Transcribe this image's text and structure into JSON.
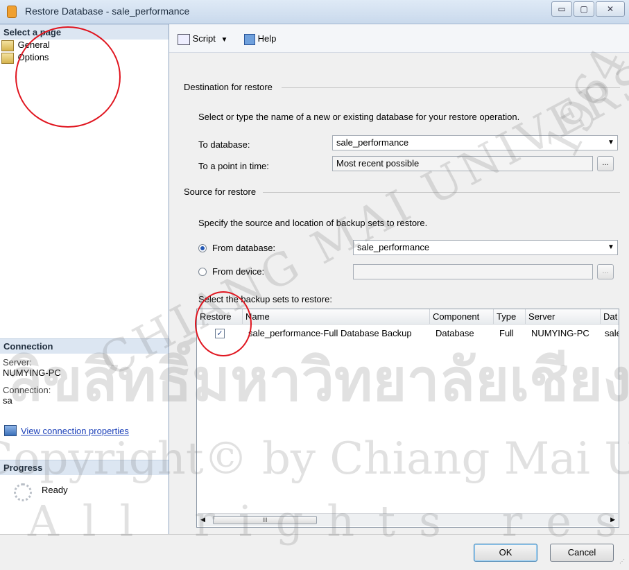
{
  "window": {
    "title": "Restore Database - sale_performance",
    "controls": {
      "minimize": "▭",
      "maximize": "▢",
      "close": "✕"
    }
  },
  "sidebar": {
    "header": "Select a page",
    "pages": [
      {
        "label": "General",
        "icon": "page-icon"
      },
      {
        "label": "Options",
        "icon": "page-icon"
      }
    ],
    "connection": {
      "header": "Connection",
      "server_label": "Server:",
      "server_value": "NUMYING-PC",
      "connection_label": "Connection:",
      "connection_value": "sa",
      "view_link": "View connection properties"
    },
    "progress": {
      "header": "Progress",
      "status": "Ready"
    }
  },
  "toolbar": {
    "script_label": "Script",
    "help_label": "Help"
  },
  "destination": {
    "group_label": "Destination for restore",
    "instruction": "Select or type the name of a new or existing database for your restore operation.",
    "to_database_label": "To database:",
    "to_database_value": "sale_performance",
    "point_in_time_label": "To a point in time:",
    "point_in_time_value": "Most recent possible",
    "ellipsis": "..."
  },
  "source": {
    "group_label": "Source for restore",
    "instruction": "Specify the source and location of backup sets to restore.",
    "from_database_label": "From database:",
    "from_database_value": "sale_performance",
    "from_device_label": "From device:",
    "ellipsis": "...",
    "selected_option": "From database"
  },
  "backup_sets": {
    "label": "Select the backup sets to restore:",
    "columns": [
      "Restore",
      "Name",
      "Component",
      "Type",
      "Server",
      "Dat"
    ],
    "rows": [
      {
        "restore": true,
        "name": "sale_performance-Full Database Backup",
        "component": "Database",
        "type": "Full",
        "server": "NUMYING-PC",
        "dat": "sale"
      }
    ],
    "scroll_thumb": "III"
  },
  "buttons": {
    "ok": "OK",
    "cancel": "Cancel"
  },
  "watermark": {
    "line1": "ลิขสิทธิ์มหาวิทยาลัยเชียงใหม่",
    "line2": "Copyright© by Chiang Mai University",
    "line3": "All rights reserved",
    "arc_text": "CHIANG MAI UNIVERSITY",
    "year": "1964"
  },
  "colors": {
    "annotation": "#e0151f",
    "link": "#1a3fb8",
    "section_header_bg": "#dce6f2"
  }
}
